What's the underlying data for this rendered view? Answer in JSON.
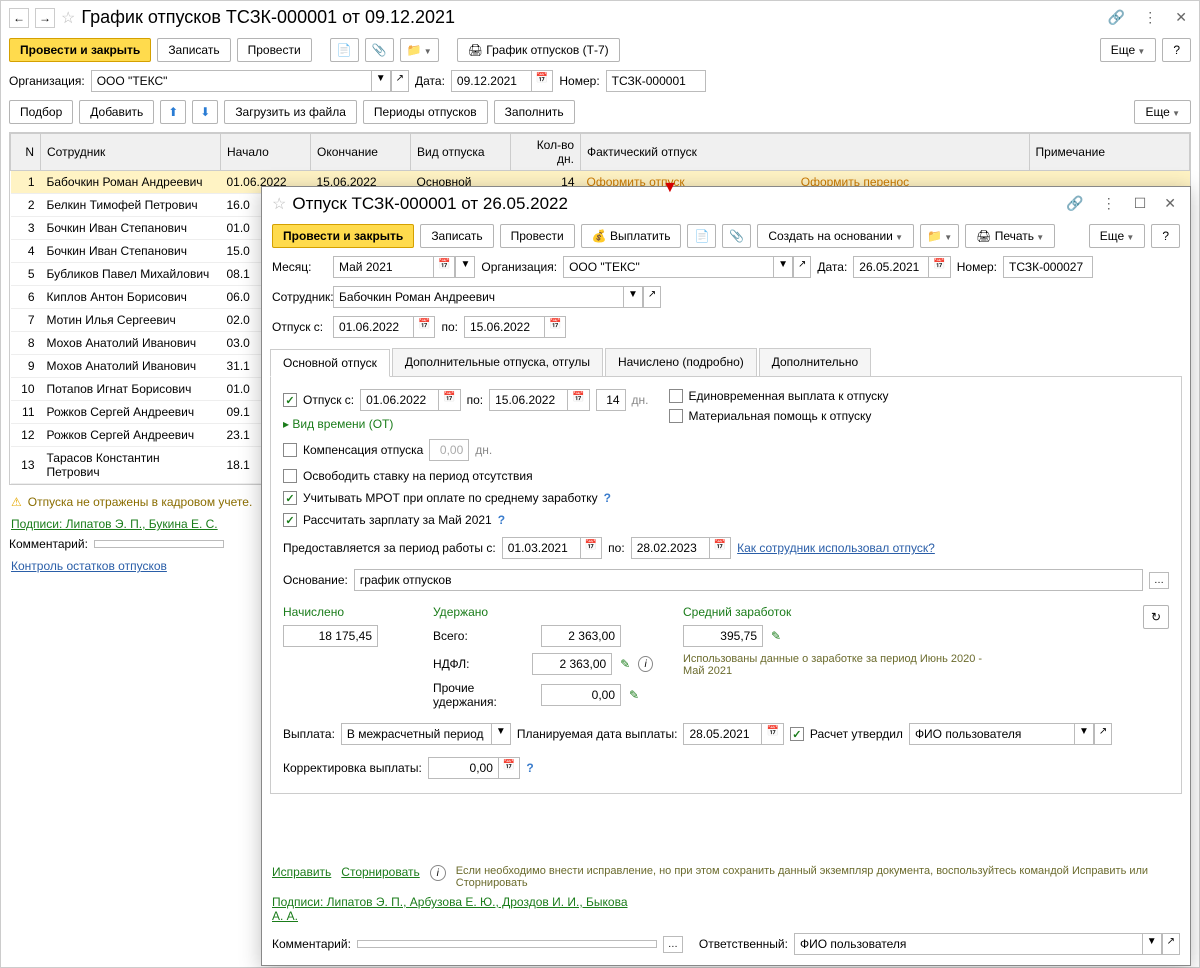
{
  "main": {
    "title": "График отпусков ТСЗК-000001 от 09.12.2021",
    "org_label": "Организация:",
    "org_value": "ООО \"ТЕКС\"",
    "date_label": "Дата:",
    "date_value": "09.12.2021",
    "number_label": "Номер:",
    "number_value": "ТСЗК-000001",
    "comment_label": "Комментарий:"
  },
  "toolbar": {
    "post_close": "Провести и закрыть",
    "save": "Записать",
    "post": "Провести",
    "print_t7": "График отпусков (Т-7)",
    "more": "Еще",
    "help": "?"
  },
  "toolbar2": {
    "select": "Подбор",
    "add": "Добавить",
    "load_file": "Загрузить из файла",
    "periods": "Периоды отпусков",
    "fill": "Заполнить",
    "more": "Еще"
  },
  "table": {
    "cols": {
      "n": "N",
      "emp": "Сотрудник",
      "start": "Начало",
      "end": "Окончание",
      "type": "Вид отпуска",
      "days": "Кол-во дн.",
      "actual": "Фактический отпуск",
      "note": "Примечание"
    },
    "link1": "Оформить отпуск",
    "link2": "Оформить перенос",
    "rows": [
      {
        "n": "1",
        "emp": "Бабочкин Роман Андреевич",
        "start": "01.06.2022",
        "end": "15.06.2022",
        "type": "Основной",
        "days": "14"
      },
      {
        "n": "2",
        "emp": "Белкин Тимофей Петрович",
        "start": "16.0"
      },
      {
        "n": "3",
        "emp": "Бочкин Иван Степанович",
        "start": "01.0"
      },
      {
        "n": "4",
        "emp": "Бочкин Иван Степанович",
        "start": "15.0"
      },
      {
        "n": "5",
        "emp": "Бубликов Павел Михайлович",
        "start": "08.1"
      },
      {
        "n": "6",
        "emp": "Киплов Антон Борисович",
        "start": "06.0"
      },
      {
        "n": "7",
        "emp": "Мотин Илья Сергеевич",
        "start": "02.0"
      },
      {
        "n": "8",
        "emp": "Мохов Анатолий Иванович",
        "start": "03.0"
      },
      {
        "n": "9",
        "emp": "Мохов Анатолий Иванович",
        "start": "31.1"
      },
      {
        "n": "10",
        "emp": "Потапов Игнат Борисович",
        "start": "01.0"
      },
      {
        "n": "11",
        "emp": "Рожков Сергей Андреевич",
        "start": "09.1"
      },
      {
        "n": "12",
        "emp": "Рожков Сергей Андреевич",
        "start": "23.1"
      },
      {
        "n": "13",
        "emp": "Тарасов Константин Петрович",
        "start": "18.1"
      }
    ]
  },
  "warning": "Отпуска не отражены в кадровом учете.",
  "signatures_main": "Подписи: Липатов Э. П., Букина Е. С.",
  "control_link": "Контроль остатков отпусков",
  "modal": {
    "title": "Отпуск ТСЗК-000001 от 26.05.2022",
    "toolbar": {
      "post_close": "Провести и закрыть",
      "save": "Записать",
      "post": "Провести",
      "pay": "Выплатить",
      "create_based": "Создать на основании",
      "print": "Печать",
      "more": "Еще",
      "help": "?"
    },
    "month_label": "Месяц:",
    "month_value": "Май 2021",
    "org_label": "Организация:",
    "org_value": "ООО \"ТЕКС\"",
    "date_label": "Дата:",
    "date_value": "26.05.2021",
    "number_label": "Номер:",
    "number_value": "ТСЗК-000027",
    "emp_label": "Сотрудник:",
    "emp_value": "Бабочкин Роман Андреевич",
    "from_label": "Отпуск с:",
    "from_value": "01.06.2022",
    "to_label": "по:",
    "to_value": "15.06.2022",
    "tabs": {
      "t1": "Основной отпуск",
      "t2": "Дополнительные отпуска, отгулы",
      "t3": "Начислено (подробно)",
      "t4": "Дополнительно"
    },
    "main_tab": {
      "vac_label": "Отпуск  с:",
      "vac_from": "01.06.2022",
      "vac_to_label": "по:",
      "vac_to": "15.06.2022",
      "days": "14",
      "days_lbl": "дн.",
      "lump": "Единовременная выплата к отпуску",
      "aid": "Материальная помощь к отпуску",
      "time_type": "Вид времени (ОТ)",
      "comp": "Компенсация отпуска",
      "comp_val": "0,00",
      "comp_days": "дн.",
      "release": "Освободить ставку на период отсутствия",
      "mrot": "Учитывать МРОТ при оплате по среднему заработку",
      "calc_salary": "Рассчитать зарплату за Май 2021",
      "period_label": "Предоставляется за период работы с:",
      "period_from": "01.03.2021",
      "period_to_label": "по:",
      "period_to": "28.02.2023",
      "usage_link": "Как сотрудник использовал отпуск?",
      "basis_label": "Основание:",
      "basis_value": "график отпусков",
      "accrued_hdr": "Начислено",
      "accrued_val": "18 175,45",
      "withheld_hdr": "Удержано",
      "total_lbl": "Всего:",
      "total_val": "2 363,00",
      "ndfl_lbl": "НДФЛ:",
      "ndfl_val": "2 363,00",
      "other_lbl": "Прочие удержания:",
      "other_val": "0,00",
      "avg_hdr": "Средний заработок",
      "avg_val": "395,75",
      "used_data": "Использованы данные о заработке за период Июнь 2020 - Май 2021",
      "payout_label": "Выплата:",
      "payout_value": "В межрасчетный период",
      "payout_date_label": "Планируемая дата выплаты:",
      "payout_date": "28.05.2021",
      "approved": "Расчет утвердил",
      "approver": "ФИО пользователя",
      "correction_label": "Корректировка выплаты:",
      "correction_val": "0,00"
    },
    "footer": {
      "fix": "Исправить",
      "reverse": "Сторнировать",
      "hint": "Если необходимо внести исправление, но при этом сохранить данный экземпляр документа, воспользуйтесь командой Исправить или Сторнировать",
      "signatures": "Подписи: Липатов Э. П., Арбузова Е. Ю., Дроздов И. И., Быкова А. А.",
      "comment_label": "Комментарий:",
      "resp_label": "Ответственный:",
      "resp_value": "ФИО пользователя"
    }
  }
}
